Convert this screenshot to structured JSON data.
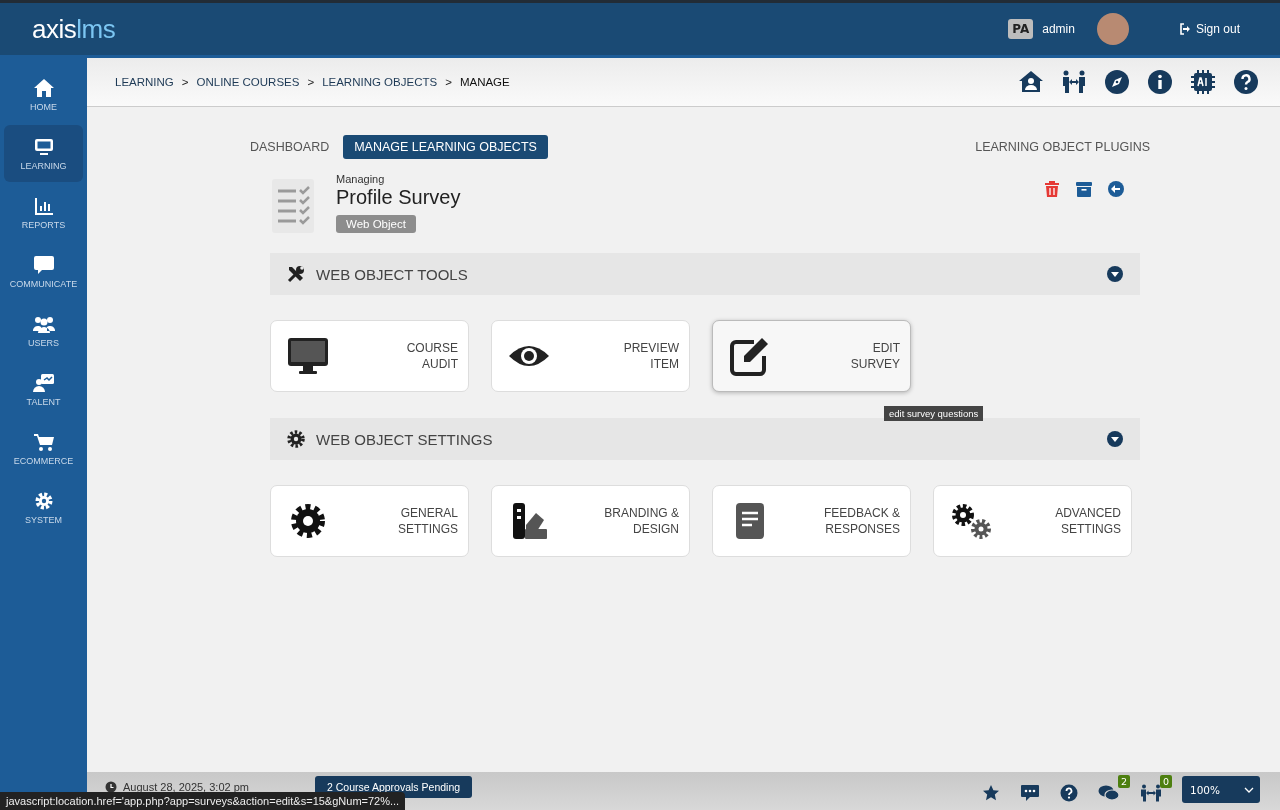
{
  "header": {
    "logo_part_1": "axis",
    "logo_part_2": "lms",
    "user_initials": "PA",
    "user_name": "admin",
    "sign_out": "Sign out"
  },
  "sidebar": {
    "items": [
      {
        "kind": "home",
        "label": "HOME",
        "selected": false
      },
      {
        "kind": "monitor",
        "label": "LEARNING",
        "selected": true
      },
      {
        "kind": "chart",
        "label": "REPORTS",
        "selected": false
      },
      {
        "kind": "chat",
        "label": "COMMUNICATE",
        "selected": false
      },
      {
        "kind": "users",
        "label": "USERS",
        "selected": false
      },
      {
        "kind": "talent",
        "label": "TALENT",
        "selected": false
      },
      {
        "kind": "cart",
        "label": "ECOMMERCE",
        "selected": false
      },
      {
        "kind": "gear",
        "label": "SYSTEM",
        "selected": false
      }
    ]
  },
  "breadcrumb": [
    {
      "label": "LEARNING",
      "current": false
    },
    {
      "separator": ">",
      "label": "ONLINE COURSES",
      "current": false
    },
    {
      "separator": ">",
      "label": "LEARNING OBJECTS",
      "current": false
    },
    {
      "separator": ">",
      "label": "MANAGE",
      "current": true
    }
  ],
  "toolbar_icons": [
    {
      "kind": "home-user"
    },
    {
      "kind": "people"
    },
    {
      "kind": "compass"
    },
    {
      "kind": "info"
    },
    {
      "kind": "ai-chip"
    },
    {
      "kind": "help"
    }
  ],
  "tabs": [
    {
      "label": "DASHBOARD",
      "selected": false
    },
    {
      "label": "MANAGE LEARNING OBJECTS",
      "selected": true
    }
  ],
  "plugins_link": "LEARNING OBJECT PLUGINS",
  "object": {
    "caption": "Managing",
    "title": "Profile Survey",
    "type_badge": "Web Object"
  },
  "sections": [
    {
      "kind": "tools",
      "title": "WEB OBJECT TOOLS",
      "expanded": true,
      "cards": [
        {
          "kind": "monitor",
          "label": "COURSE\nAUDIT",
          "hovered": false
        },
        {
          "kind": "eye",
          "label": "PREVIEW\nITEM",
          "hovered": false
        },
        {
          "kind": "edit",
          "label": "EDIT\nSURVEY",
          "hovered": true,
          "tooltip": "edit survey questions"
        }
      ]
    },
    {
      "kind": "gear",
      "title": "WEB OBJECT SETTINGS",
      "expanded": true,
      "cards": [
        {
          "kind": "gear",
          "label": "GENERAL\nSETTINGS",
          "hovered": false
        },
        {
          "kind": "swatch",
          "label": "BRANDING &\nDESIGN",
          "hovered": false
        },
        {
          "kind": "document",
          "label": "FEEDBACK &\nRESPONSES",
          "hovered": false
        },
        {
          "kind": "gears",
          "label": "ADVANCED\nSETTINGS",
          "hovered": false
        }
      ]
    }
  ],
  "footer": {
    "date": "August 28, 2025, 3:02 pm",
    "pending_button": "2 Course Approvals Pending",
    "messages_badge": "2",
    "connections_badge": "0",
    "zoom": "100%"
  },
  "status_url": "javascript:location.href='app.php?app=surveys&action=edit&s=15&gNum=72%..."
}
